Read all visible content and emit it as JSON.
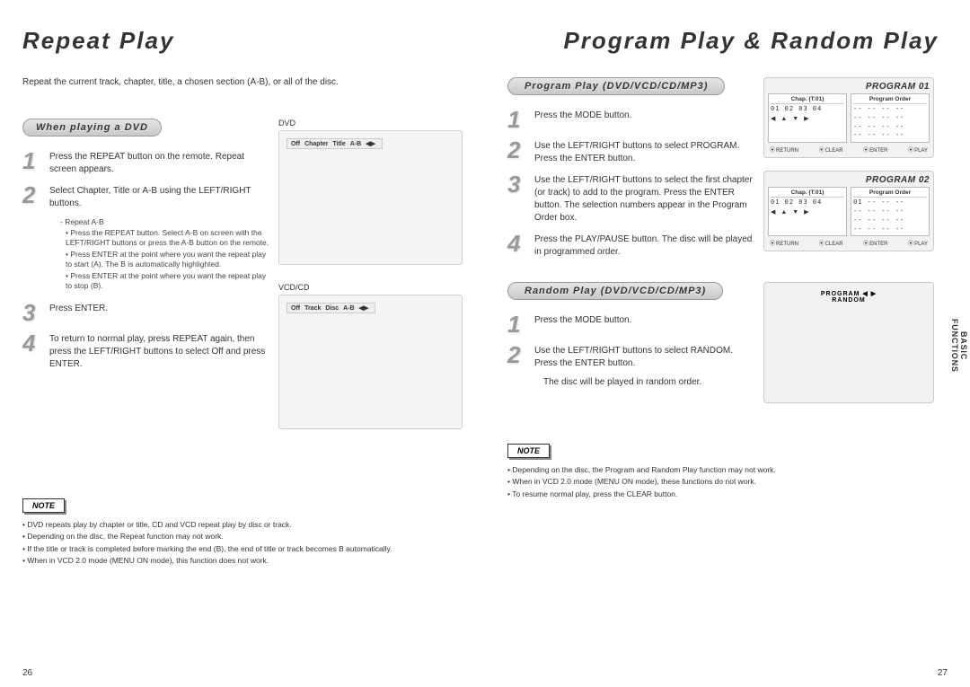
{
  "left": {
    "title": "Repeat Play",
    "intro": "Repeat the current track, chapter, title, a chosen section (A-B), or all of the disc.",
    "pill": "When playing a DVD",
    "steps": [
      "Press the REPEAT button on the remote. Repeat screen appears.",
      "Select Chapter, Title or A-B using the LEFT/RIGHT buttons.",
      "Press ENTER.",
      "To return to normal play, press REPEAT again, then press the LEFT/RIGHT buttons to select Off and press ENTER."
    ],
    "sub_head": "- Repeat A-B",
    "sub_bullets": [
      "Press the REPEAT button. Select A-B on screen with the LEFT/RIGHT buttons or press the A-B button on the remote.",
      "Press ENTER at the point where you want the repeat play to start (A). The B is automatically highlighted.",
      "Press ENTER at the point where you want the repeat play to stop (B)."
    ],
    "screen1_cap": "DVD",
    "screen1_bar": [
      "Off",
      "Chapter",
      "Title",
      "A-B",
      "◀▶"
    ],
    "screen2_cap": "VCD/CD",
    "screen2_bar": [
      "Off",
      "Track",
      "Disc",
      "A-B",
      "◀▶"
    ],
    "note_label": "NOTE",
    "notes": [
      "DVD repeats play by chapter or title, CD and VCD repeat play by disc or track.",
      "Depending on the disc, the Repeat function may not work.",
      "If the title or track is completed before marking the end (B), the end of title or track becomes B automatically.",
      "When in VCD 2.0 mode (MENU ON mode), this function does not work."
    ],
    "page_num": "26"
  },
  "right": {
    "title": "Program Play & Random Play",
    "pill_prog": "Program Play (DVD/VCD/CD/MP3)",
    "steps_prog": [
      "Press the MODE button.",
      "Use the LEFT/RIGHT buttons to select PROGRAM. Press the ENTER button.",
      "Use the LEFT/RIGHT buttons to select the first chapter (or track) to add to the program. Press the ENTER button. The selection numbers appear in the Program Order box.",
      "Press the PLAY/PAUSE button. The disc will be played in programmed order."
    ],
    "pill_rand": "Random Play (DVD/VCD/CD/MP3)",
    "steps_rand": [
      "Press the MODE button.",
      "Use the LEFT/RIGHT buttons to select RANDOM. Press the ENTER button."
    ],
    "rand_note": "The disc will be played in random order.",
    "prog1_title": "PROGRAM 01",
    "prog2_title": "PROGRAM 02",
    "prog_chap_hd": "Chap. (T:01)",
    "prog_order_hd": "Program Order",
    "prog_nums": "01 02 03 04",
    "prog_order1": "01  --  --  --",
    "prog_dashes": "--  --  --  --",
    "prog_arrs": "◀ ▲ ▼ ▶",
    "prog_foot": [
      "RETURN",
      "CLEAR",
      "ENTER",
      "PLAY"
    ],
    "rand_bar": "PROGRAM  ◀ ▶  RANDOM",
    "note_label": "NOTE",
    "notes": [
      "Depending on the disc, the Program and Random Play function may not work.",
      "When in VCD 2.0 mode (MENU ON mode), these functions do not work.",
      "To resume normal play, press the CLEAR button."
    ],
    "page_num": "27",
    "side_tab_1": "BASIC",
    "side_tab_2": "FUNCTIONS"
  }
}
